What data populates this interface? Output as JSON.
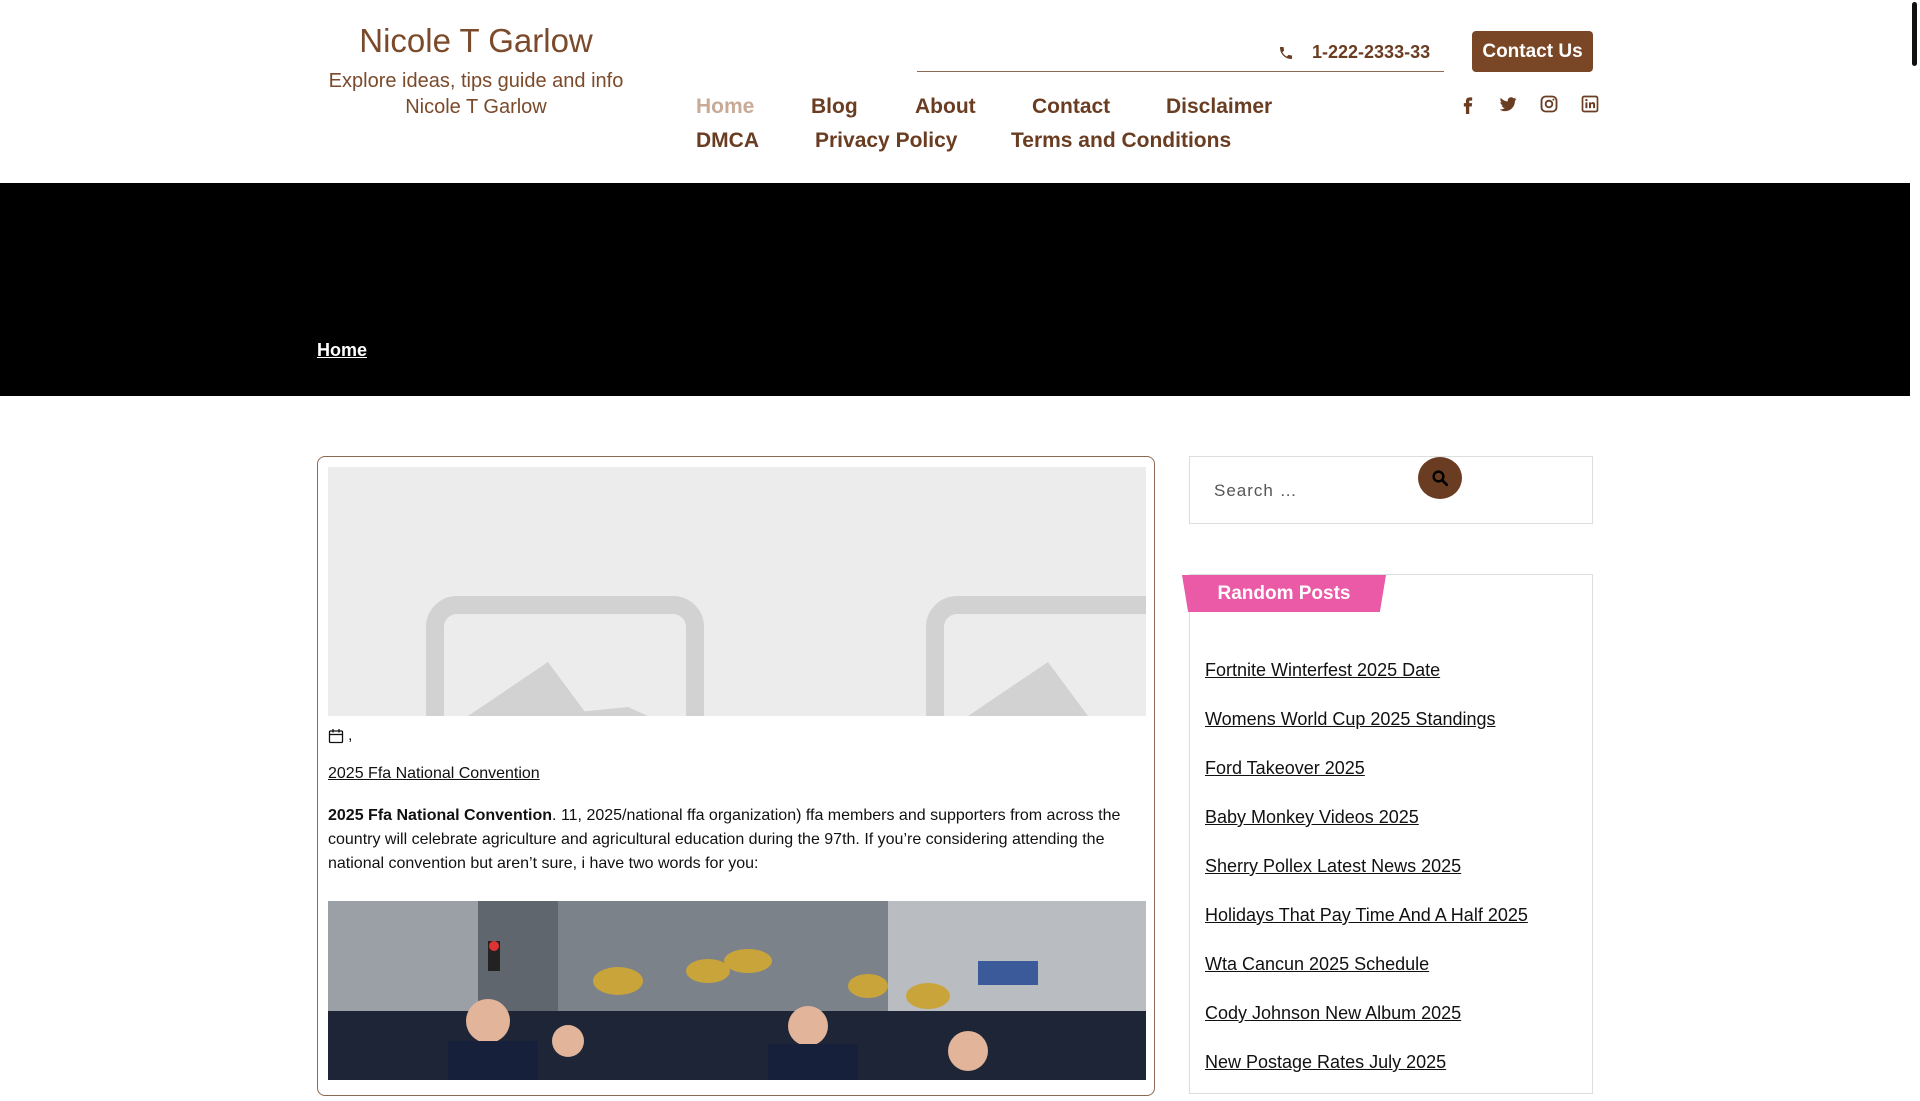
{
  "site": {
    "title": "Nicole T Garlow",
    "tagline": "Explore ideas, tips guide and info Nicole T Garlow"
  },
  "header": {
    "phone": "1-222-2333-33",
    "contact_button": "Contact Us"
  },
  "nav": {
    "row1": [
      "Home",
      "Blog",
      "About",
      "Contact",
      "Disclaimer"
    ],
    "row2": [
      "DMCA",
      "Privacy Policy",
      "Terms and Conditions"
    ],
    "active": "Home"
  },
  "social": [
    "facebook-icon",
    "twitter-icon",
    "instagram-icon",
    "linkedin-icon"
  ],
  "breadcrumb": {
    "home": "Home"
  },
  "post": {
    "date_suffix": ",",
    "title_link": "2025 Ffa National Convention",
    "excerpt_bold": "2025 Ffa National Convention",
    "excerpt_rest": ". 11, 2025/national ffa organization) ffa members and supporters from across the country will celebrate agriculture and agricultural education during the 97th. If you’re considering attending the national convention but aren’t sure, i have two words for you:"
  },
  "search": {
    "placeholder": "Search …"
  },
  "sidebar": {
    "widget_title": "Random Posts",
    "posts": [
      "Fortnite Winterfest 2025 Date",
      "Womens World Cup 2025 Standings",
      "Ford Takeover 2025",
      "Baby Monkey Videos 2025",
      "Sherry Pollex Latest News 2025",
      "Holidays That Pay Time And A Half 2025",
      "Wta Cancun 2025 Schedule",
      "Cody Johnson New Album 2025",
      "New Postage Rates July 2025"
    ]
  },
  "colors": {
    "brand_brown": "#7a4726",
    "nav_text": "#6a3d22",
    "nav_active": "#c8aa96",
    "banner": "#000000",
    "widget_tab": "#ea5aa6"
  }
}
